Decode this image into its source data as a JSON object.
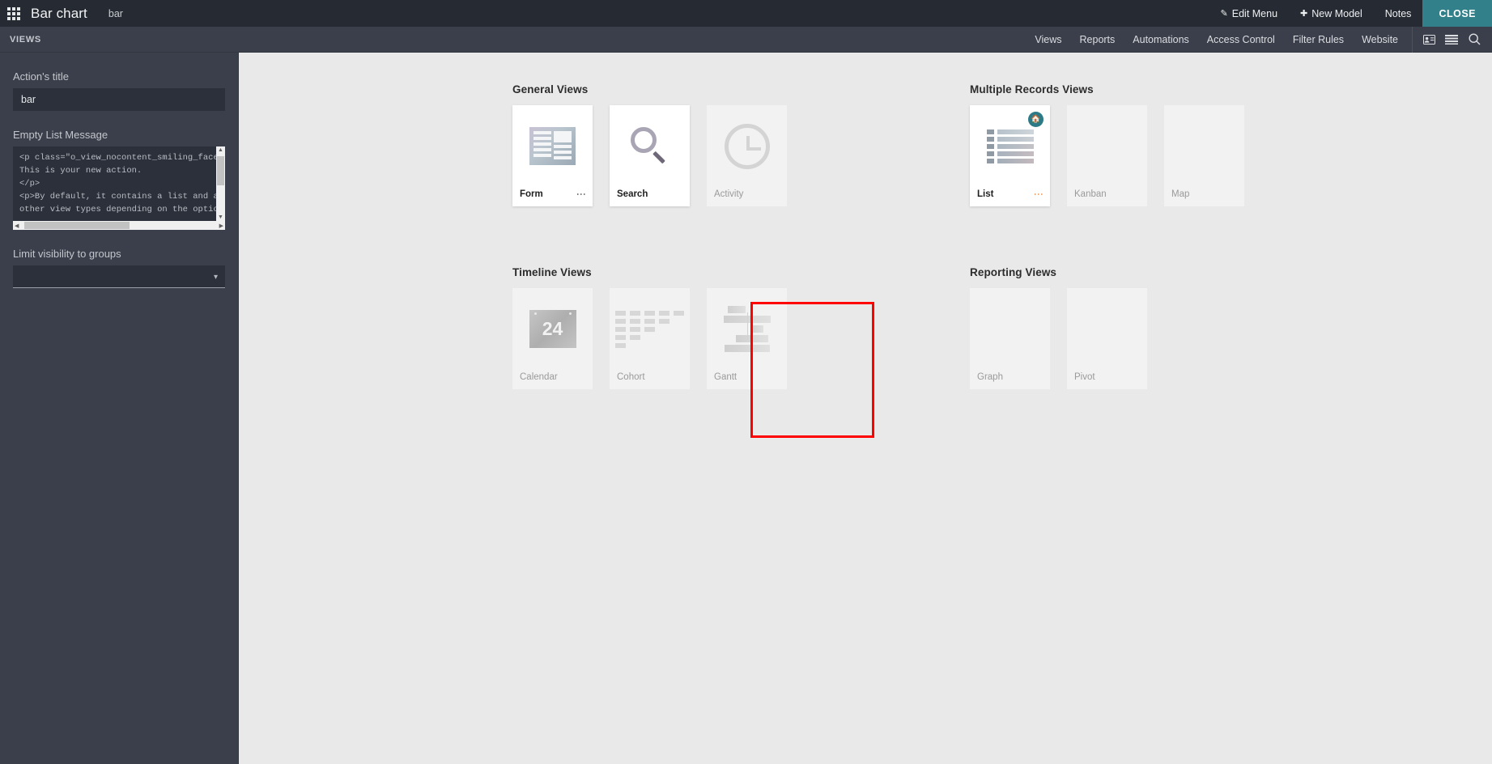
{
  "topbar": {
    "apps_icon": "apps-grid-icon",
    "app_title": "Bar chart",
    "breadcrumb": "bar",
    "edit_menu": "Edit Menu",
    "edit_menu_icon": "pencil-icon",
    "new_model": "New Model",
    "new_model_icon": "plus-icon",
    "notes": "Notes",
    "close": "CLOSE",
    "close_color": "#31808a"
  },
  "subbar": {
    "views_label": "VIEWS",
    "items": [
      {
        "label": "Views"
      },
      {
        "label": "Reports"
      },
      {
        "label": "Automations"
      },
      {
        "label": "Access Control"
      },
      {
        "label": "Filter Rules"
      },
      {
        "label": "Website"
      }
    ],
    "icons": [
      {
        "name": "contact-card-icon"
      },
      {
        "name": "list-menu-icon"
      },
      {
        "name": "search-icon"
      }
    ]
  },
  "sidebar": {
    "action_title_label": "Action's title",
    "action_title_value": "bar",
    "empty_list_label": "Empty List Message",
    "empty_list_value": "<p class=\"o_view_nocontent_smiling_face\">\nThis is your new action.\n</p>\n<p>By default, it contains a list and a form\nother view types depending on the options yo",
    "limit_groups_label": "Limit visibility to groups",
    "limit_groups_value": ""
  },
  "main": {
    "sections": [
      {
        "title": "General Views",
        "cards": [
          {
            "name": "Form",
            "state": "active",
            "art": "form",
            "kebab": true,
            "home": false
          },
          {
            "name": "Search",
            "state": "active",
            "art": "search",
            "kebab": false,
            "home": false
          },
          {
            "name": "Activity",
            "state": "inactive",
            "art": "clock",
            "kebab": false,
            "home": false
          }
        ]
      },
      {
        "title": "Multiple Records Views",
        "cards": [
          {
            "name": "List",
            "state": "active",
            "art": "list",
            "kebab": true,
            "home": true
          },
          {
            "name": "Kanban",
            "state": "inactive",
            "art": "none",
            "kebab": false,
            "home": false
          },
          {
            "name": "Map",
            "state": "inactive",
            "art": "none",
            "kebab": false,
            "home": false
          }
        ]
      },
      {
        "title": "Timeline Views",
        "cards": [
          {
            "name": "Calendar",
            "state": "inactive",
            "art": "calendar",
            "kebab": false,
            "home": false
          },
          {
            "name": "Cohort",
            "state": "inactive",
            "art": "cohort",
            "kebab": false,
            "home": false
          },
          {
            "name": "Gantt",
            "state": "inactive",
            "art": "gantt",
            "kebab": false,
            "home": false
          }
        ]
      },
      {
        "title": "Reporting Views",
        "cards": [
          {
            "name": "Graph",
            "state": "inactive",
            "art": "none",
            "kebab": false,
            "home": false
          },
          {
            "name": "Pivot",
            "state": "inactive",
            "art": "none",
            "kebab": false,
            "home": false
          }
        ]
      }
    ],
    "calendar_day": "24",
    "highlight": {
      "color": "#ff0000",
      "target": "Graph"
    }
  }
}
